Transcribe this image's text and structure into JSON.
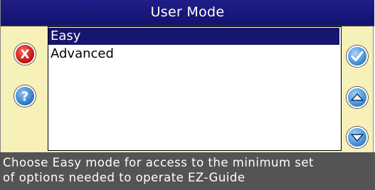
{
  "dialog": {
    "title": "User Mode",
    "options": [
      {
        "label": "Easy",
        "selected": true
      },
      {
        "label": "Advanced",
        "selected": false
      }
    ]
  },
  "buttons": {
    "cancel": {
      "icon": "cancel-x-icon",
      "glyph": "X",
      "color": "#c41212"
    },
    "help": {
      "icon": "help-question-icon",
      "glyph": "?",
      "color": "#2f78c8"
    },
    "ok": {
      "icon": "checkmark-icon",
      "color": "#3d8ad4"
    },
    "up": {
      "icon": "arrow-up-icon",
      "color": "#3d8ad4"
    },
    "down": {
      "icon": "arrow-down-icon",
      "color": "#3d8ad4"
    }
  },
  "help": {
    "line1": "Choose Easy mode for access to the minimum set",
    "line2": "of options needed to operate EZ-Guide"
  },
  "colors": {
    "titlebar": "#131370",
    "panel": "#f7f0b8",
    "selection": "#16166e",
    "helpbar": "#545454"
  }
}
